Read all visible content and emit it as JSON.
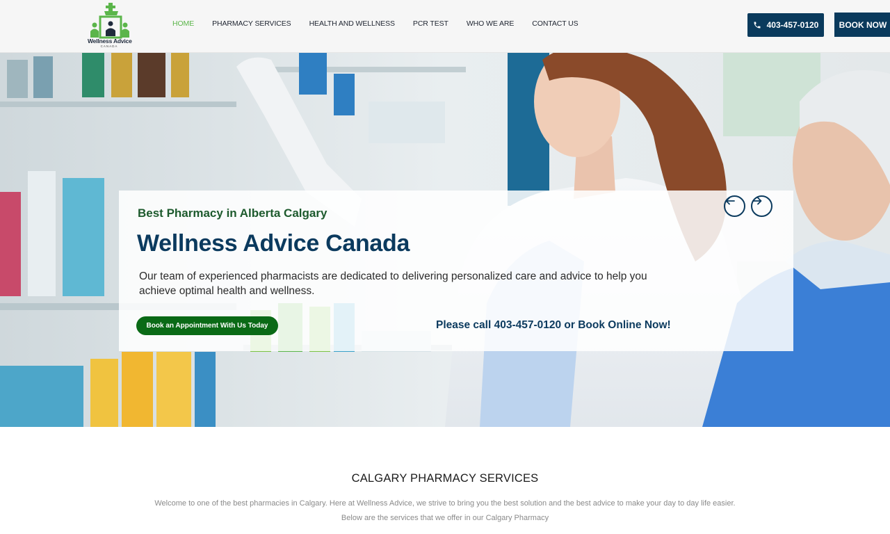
{
  "header": {
    "logo": {
      "name": "Wellness Advice",
      "sub": "CANADA",
      "brand_color": "#5bb54a"
    },
    "nav": [
      {
        "label": "HOME",
        "active": true
      },
      {
        "label": "PHARMACY SERVICES",
        "active": false
      },
      {
        "label": "HEALTH AND WELLNESS",
        "active": false
      },
      {
        "label": "PCR TEST",
        "active": false
      },
      {
        "label": "WHO WE ARE",
        "active": false
      },
      {
        "label": "CONTACT US",
        "active": false
      }
    ],
    "phone": {
      "label": "403-457-0120",
      "icon": "phone-icon"
    },
    "book_now": "BOOK NOW",
    "accent": "#0a3a5c"
  },
  "hero": {
    "eyebrow": "Best Pharmacy in Alberta Calgary",
    "title": "Wellness Advice Canada",
    "description": "Our team of experienced pharmacists are dedicated to delivering personalized care and advice to help you achieve optimal health and wellness.",
    "cta": "Book an Appointment With Us Today",
    "call_text": "Please call 403-457-0120 or Book Online Now!",
    "prev_icon": "arrow-left-icon",
    "next_icon": "arrow-right-icon"
  },
  "services": {
    "title": "CALGARY PHARMACY SERVICES",
    "line1": "Welcome to one of the best pharmacies in Calgary. Here at Wellness Advice, we strive to bring you the best solution and the best advice to make your day to day life easier.",
    "line2": "Below are the services that we offer in our Calgary Pharmacy"
  }
}
